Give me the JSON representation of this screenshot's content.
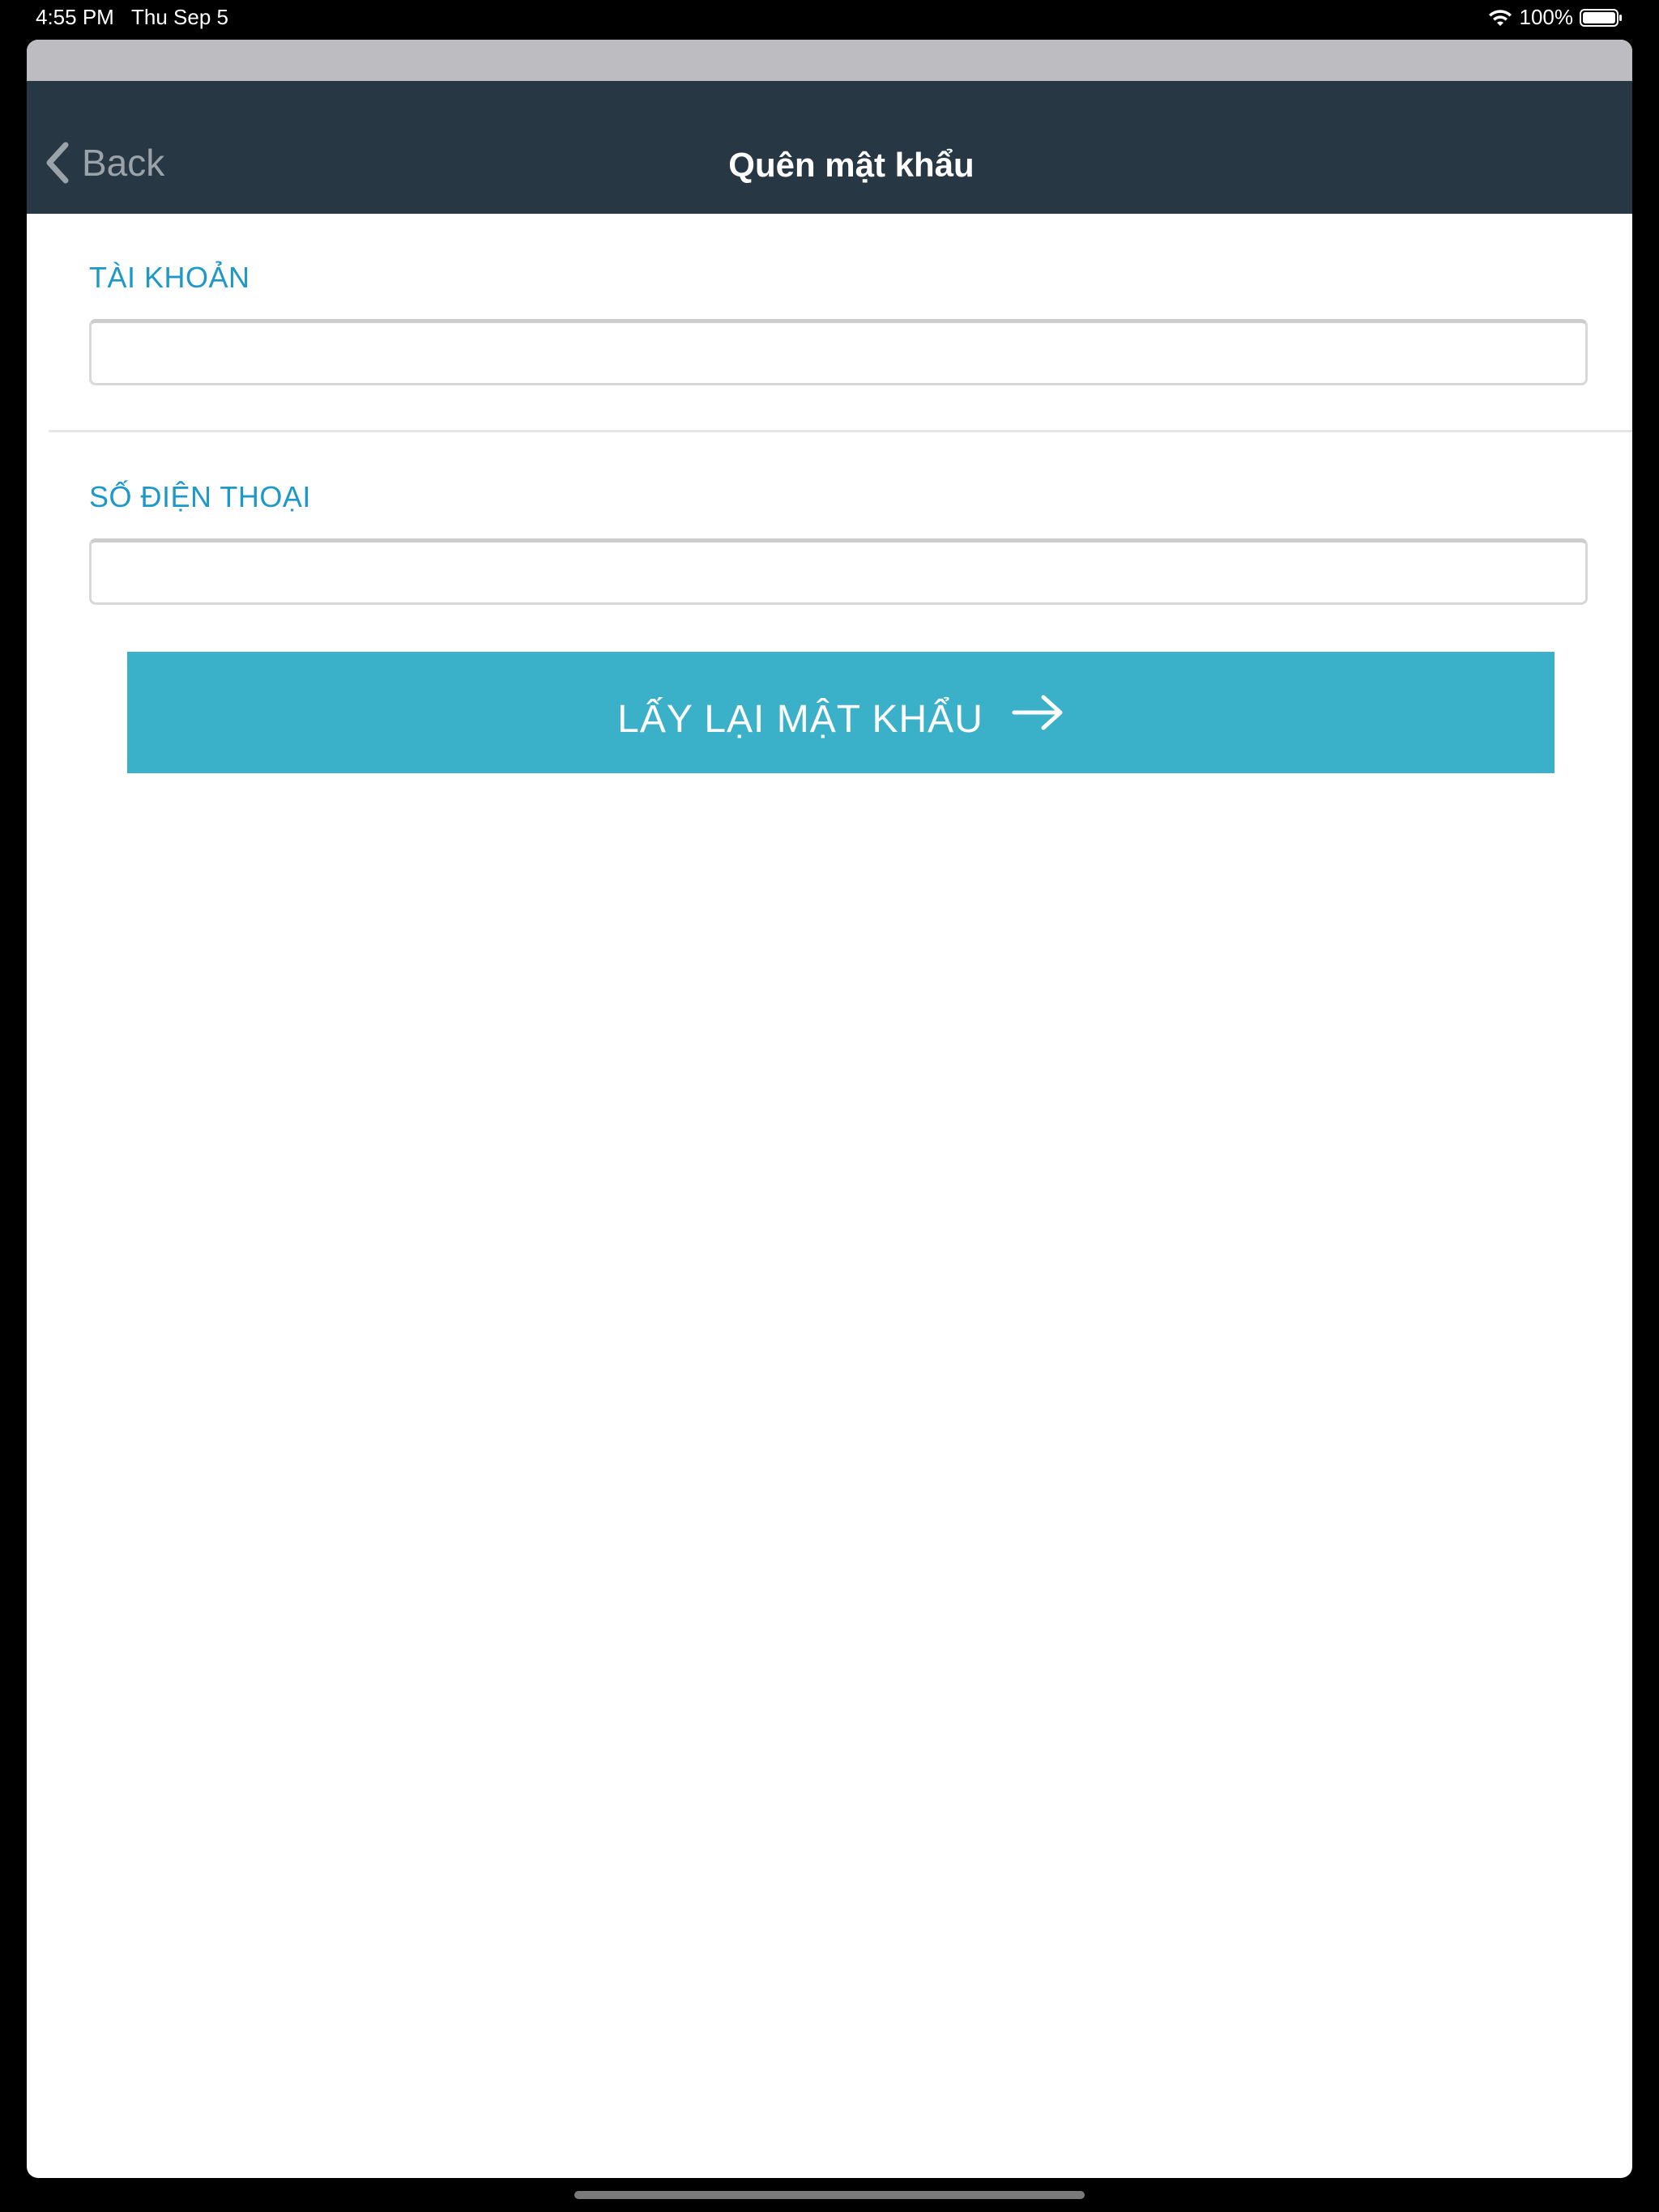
{
  "status_bar": {
    "time": "4:55 PM",
    "date": "Thu Sep 5",
    "battery": "100%"
  },
  "nav": {
    "back_label": "Back",
    "title": "Quên mật khẩu"
  },
  "form": {
    "account_label": "TÀI KHOẢN",
    "account_value": "",
    "phone_label": "SỐ ĐIỆN THOẠI",
    "phone_value": "",
    "submit_label": "LẤY LẠI MẬT KHẨU"
  },
  "colors": {
    "nav_background": "#273844",
    "accent_label": "#1e98c9",
    "button_background": "#3ab1c9"
  },
  "icons": {
    "back": "chevron-left-icon",
    "submit": "arrow-right-icon",
    "wifi": "wifi-icon",
    "battery": "battery-icon"
  }
}
